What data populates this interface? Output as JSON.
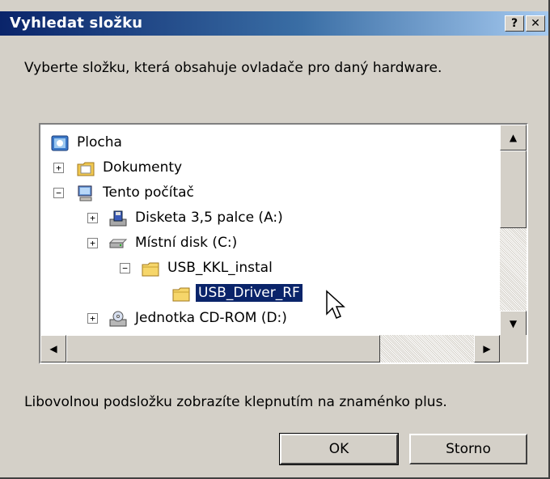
{
  "dialog": {
    "title": "Vyhledat složku",
    "help_glyph": "?",
    "close_glyph": "✕",
    "prompt": "Vyberte složku, která obsahuje ovladače pro daný hardware.",
    "hint": "Libovolnou podsložku zobrazíte klepnutím na znaménko plus."
  },
  "tree": {
    "nodes": [
      {
        "label": "Plocha",
        "icon": "desktop-icon",
        "expander": ""
      },
      {
        "label": "Dokumenty",
        "icon": "documents-folder-icon",
        "expander": "+"
      },
      {
        "label": "Tento počítač",
        "icon": "my-computer-icon",
        "expander": "−"
      },
      {
        "label": "Disketa 3,5 palce (A:)",
        "icon": "floppy-drive-icon",
        "expander": "+"
      },
      {
        "label": "Místní disk (C:)",
        "icon": "hard-disk-icon",
        "expander": "+"
      },
      {
        "label": "USB_KKL_instal",
        "icon": "folder-icon",
        "expander": "−"
      },
      {
        "label": "USB_Driver_RF",
        "icon": "folder-icon",
        "expander": "",
        "selected": true
      },
      {
        "label": "Jednotka CD-ROM (D:)",
        "icon": "cd-drive-icon",
        "expander": "+"
      }
    ]
  },
  "scrollbars": {
    "up": "▲",
    "down": "▼",
    "left": "◀",
    "right": "▶"
  },
  "buttons": {
    "ok": "OK",
    "cancel": "Storno"
  },
  "colors": {
    "title_start": "#0a246a",
    "title_end": "#a6caf0",
    "selection": "#0a246a",
    "face": "#d4d0c8"
  }
}
